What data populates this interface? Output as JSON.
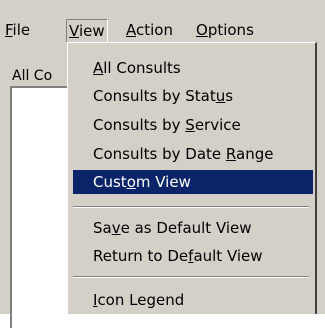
{
  "menubar": {
    "items": [
      {
        "label": "File"
      },
      {
        "label": "View"
      },
      {
        "label": "Action"
      },
      {
        "label": "Options"
      }
    ]
  },
  "list": {
    "header": "All Co"
  },
  "view_menu": {
    "items": [
      {
        "label": "All Consults"
      },
      {
        "label": "Consults by Status"
      },
      {
        "label": "Consults by Service"
      },
      {
        "label": "Consults by Date Range"
      },
      {
        "label": "Custom View",
        "highlighted": true
      },
      {
        "label": "Save as Default View"
      },
      {
        "label": "Return to Default View"
      },
      {
        "label": "Icon Legend"
      }
    ]
  },
  "colors": {
    "menu_face": "#d4d0c8",
    "highlight": "#0a246a",
    "highlight_text": "#ffffff"
  }
}
